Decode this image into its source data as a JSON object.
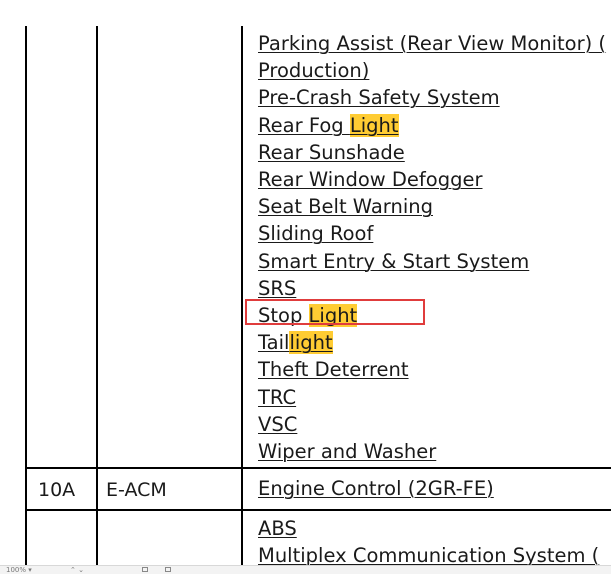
{
  "rows_top": {
    "items": [
      {
        "text": "Parking Assist (Rear View Monitor) ("
      },
      {
        "text": "Production)"
      },
      {
        "text": "Pre-Crash Safety System"
      },
      {
        "pre": "Rear Fog ",
        "hl": "Light",
        "post": ""
      },
      {
        "text": "Rear Sunshade"
      },
      {
        "text": "Rear Window Defogger"
      },
      {
        "text": "Seat Belt Warning"
      },
      {
        "text": "Sliding Roof"
      },
      {
        "text": "Smart Entry & Start System"
      },
      {
        "text": "SRS"
      },
      {
        "pre": "Stop ",
        "hl": "Light",
        "post": ""
      },
      {
        "pre": "Tail",
        "hl": "light",
        "post": ""
      },
      {
        "text": "Theft Deterrent"
      },
      {
        "text": "TRC"
      },
      {
        "text": "VSC"
      },
      {
        "text": "Wiper and Washer"
      }
    ]
  },
  "row_10a": {
    "amp": "10A",
    "name": "E-ACM",
    "circuit": "Engine Control (2GR-FE)"
  },
  "rows_bottom": {
    "items": [
      {
        "text": "ABS"
      },
      {
        "text": "Multiplex Communication System ("
      }
    ]
  },
  "highlight_color": "#ffcc33",
  "selection_box_color": "#e03c3c",
  "statusbar": {
    "left_text": "100% ▾",
    "mid_text": "⌃ ⌄"
  }
}
